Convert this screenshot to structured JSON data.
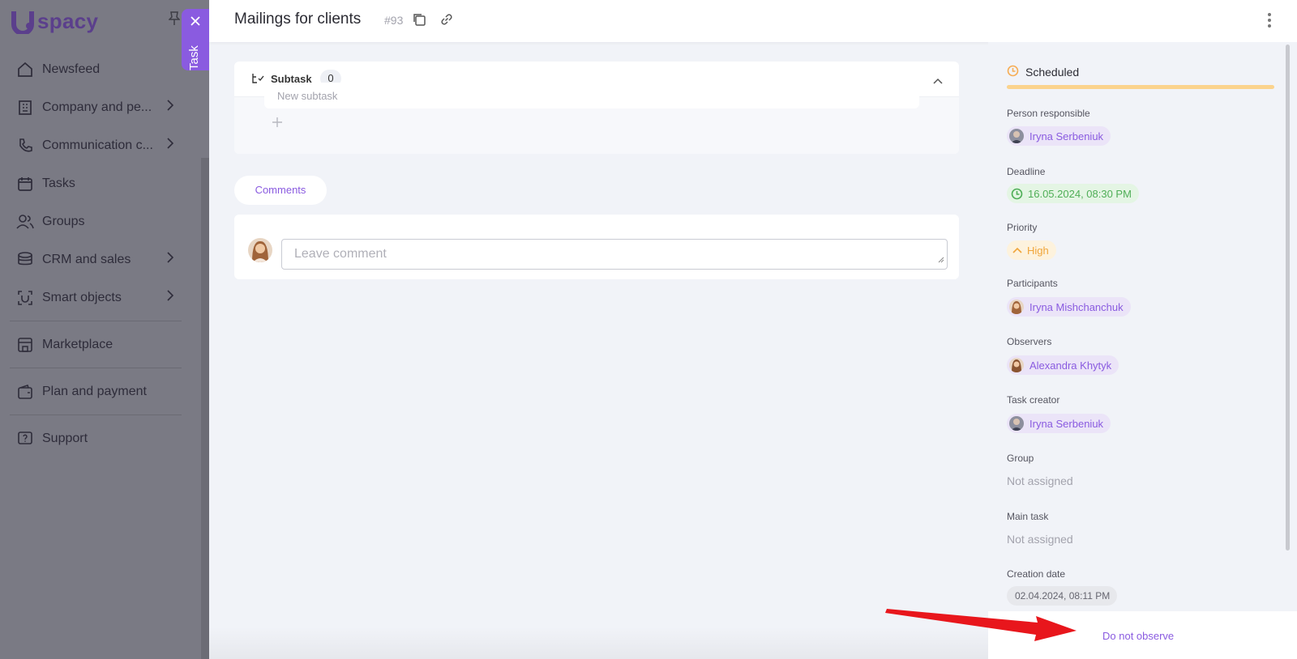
{
  "brand": {
    "logo_text": "spacy"
  },
  "sidebar": {
    "items": [
      {
        "label": "Newsfeed",
        "icon": "home-icon",
        "has_chevron": false
      },
      {
        "label": "Company and pe...",
        "icon": "building-icon",
        "has_chevron": true
      },
      {
        "label": "Communication c...",
        "icon": "phone-icon",
        "has_chevron": true
      },
      {
        "label": "Tasks",
        "icon": "calendar-icon",
        "has_chevron": false
      },
      {
        "label": "Groups",
        "icon": "users-icon",
        "has_chevron": false
      },
      {
        "label": "CRM and sales",
        "icon": "coins-icon",
        "has_chevron": true
      },
      {
        "label": "Smart objects",
        "icon": "scan-icon",
        "has_chevron": true
      },
      {
        "label": "Marketplace",
        "icon": "store-icon",
        "has_chevron": false
      },
      {
        "label": "Plan and payment",
        "icon": "wallet-icon",
        "has_chevron": false
      },
      {
        "label": "Support",
        "icon": "help-icon",
        "has_chevron": false
      }
    ]
  },
  "task_tab": {
    "label": "Task"
  },
  "header": {
    "title": "Mailings for clients",
    "task_number": "#93"
  },
  "subtask": {
    "label": "Subtask",
    "count": "0",
    "new_placeholder": "New subtask"
  },
  "comments": {
    "tab_label": "Comments",
    "placeholder": "Leave comment"
  },
  "info": {
    "status": "Scheduled",
    "person_responsible": {
      "label": "Person responsible",
      "name": "Iryna Serbeniuk"
    },
    "deadline": {
      "label": "Deadline",
      "value": "16.05.2024, 08:30 PM"
    },
    "priority": {
      "label": "Priority",
      "value": "High"
    },
    "participants": {
      "label": "Participants",
      "name": "Iryna Mishchanchuk"
    },
    "observers": {
      "label": "Observers",
      "name": "Alexandra Khytyk"
    },
    "task_creator": {
      "label": "Task creator",
      "name": "Iryna Serbeniuk"
    },
    "group": {
      "label": "Group",
      "value": "Not assigned"
    },
    "main_task": {
      "label": "Main task",
      "value": "Not assigned"
    },
    "creation_date": {
      "label": "Creation date",
      "value": "02.04.2024, 08:11 PM"
    }
  },
  "footer": {
    "action_label": "Do not observe"
  },
  "colors": {
    "accent": "#8a5be0",
    "status": "#f6ad55",
    "deadline": "#4fae57",
    "priority": "#f0a53a",
    "arrow": "#e8161c"
  }
}
